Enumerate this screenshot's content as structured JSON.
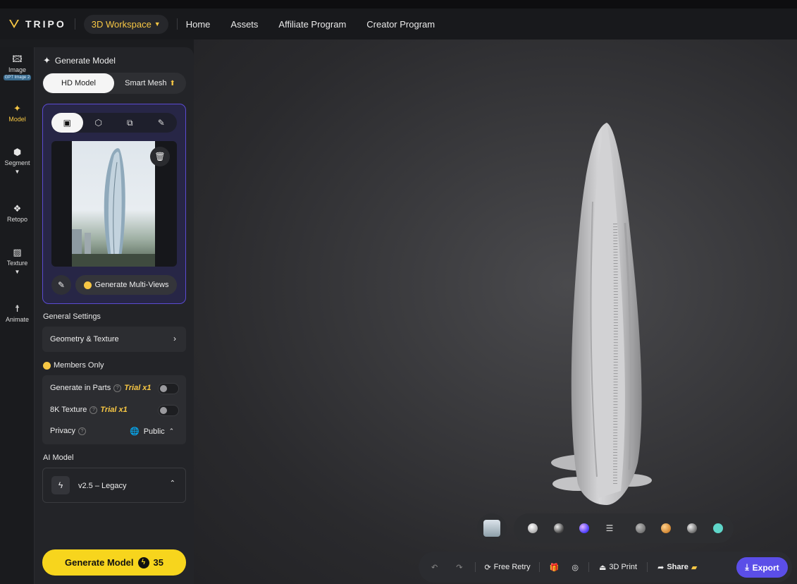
{
  "topbar": {
    "brand": "TRIPO",
    "workspace_label": "3D Workspace",
    "nav": [
      "Home",
      "Assets",
      "Affiliate Program",
      "Creator Program"
    ]
  },
  "rail": {
    "image": "Image",
    "image_badge": "GPT Image 2",
    "model": "Model",
    "segment": "Segment",
    "retopo": "Retopo",
    "texture": "Texture",
    "animate": "Animate"
  },
  "panel": {
    "title": "Generate Model",
    "mode_hd": "HD Model",
    "mode_smart": "Smart Mesh",
    "generate_multiviews": "Generate Multi-Views",
    "general_settings": "General Settings",
    "geometry_texture": "Geometry & Texture",
    "members_only": "Members Only",
    "generate_in_parts": "Generate in Parts",
    "trial": "Trial x1",
    "texture_8k": "8K Texture",
    "privacy": "Privacy",
    "privacy_value": "Public",
    "ai_model": "AI Model",
    "ai_model_value": "v2.5 – Legacy",
    "generate_button": "Generate Model",
    "generate_cost": "35"
  },
  "bottom": {
    "free_retry": "Free Retry",
    "print_3d": "3D Print",
    "share": "Share",
    "export": "Export"
  },
  "colors": {
    "accent_yellow": "#f7c744",
    "generate_yellow": "#f7d51d",
    "export_purple": "#5b4ee8",
    "upload_border": "#5b4bd2"
  },
  "icons": [
    "image-icon",
    "sparkle-icon",
    "cube-icon",
    "retopo-icon",
    "texture-icon",
    "animate-icon",
    "trash-icon",
    "pencil-icon",
    "undo-icon",
    "redo-icon",
    "gift-icon",
    "share-icon",
    "download-icon"
  ]
}
